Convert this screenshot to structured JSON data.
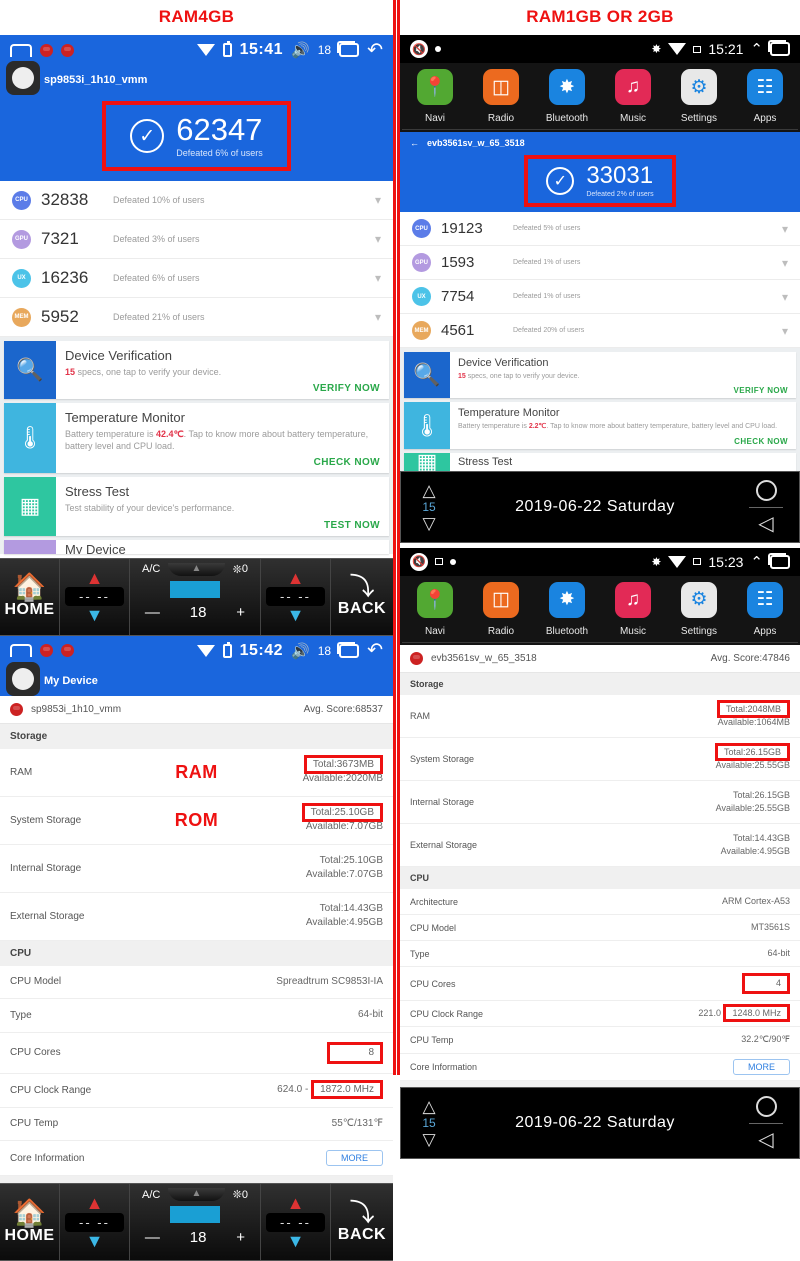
{
  "captions": {
    "left": "RAM4GB",
    "right": "RAM1GB OR 2GB"
  },
  "colors": {
    "accent_red": "#ee1111",
    "android_blue": "#1a66dd",
    "green_action": "#2aa84a",
    "cpu_badge": "#5b7ce8",
    "gpu_badge": "#b39ae0",
    "ux_badge": "#4cc3e8",
    "mem_badge": "#e8a85c"
  },
  "left": {
    "statusbar": {
      "home_icon": "home-outline-icon",
      "bug_icon_1": "bug-icon",
      "bug_icon_2": "bug-icon",
      "wifi_icon": "wifi-icon",
      "battery_icon": "battery-icon",
      "clock": "15:41",
      "volume_icon": "speaker-icon",
      "volume_value": "18",
      "recents_icon": "recents-icon",
      "back_icon": "back-arrow-icon"
    },
    "device_name": "sp9853i_1h10_vmm",
    "score": {
      "check_icon": "check-circle-icon",
      "value": "62347",
      "sub": "Defeated 6% of users",
      "highlighted": true
    },
    "metrics": [
      {
        "badge": "CPU",
        "value": "32838",
        "sub": "Defeated 10% of users",
        "chevron": "chevron-down-icon"
      },
      {
        "badge": "GPU",
        "value": "7321",
        "sub": "Defeated 3% of users",
        "chevron": "chevron-down-icon"
      },
      {
        "badge": "UX",
        "value": "16236",
        "sub": "Defeated 6% of users",
        "chevron": "chevron-down-icon"
      },
      {
        "badge": "MEM",
        "value": "5952",
        "sub": "Defeated 21% of users",
        "chevron": "chevron-down-icon"
      }
    ],
    "cards": [
      {
        "icon": "phone-search-icon",
        "title": "Device Verification",
        "desc_pre": "",
        "desc_em": "15",
        "desc_post": " specs, one tap to verify your device.",
        "action": "VERIFY NOW",
        "color": "#1b66cc"
      },
      {
        "icon": "thermometer-chart-icon",
        "title": "Temperature Monitor",
        "desc_pre": "Battery temperature is ",
        "desc_em": "42.4℃",
        "desc_post": ". Tap to know more about battery temperature, battery level and CPU load.",
        "action": "CHECK NOW",
        "color": "#3fb5df"
      },
      {
        "icon": "cpu-chip-icon",
        "title": "Stress Test",
        "desc_pre": "Test stability of your device's performance.",
        "desc_em": "",
        "desc_post": "",
        "action": "TEST NOW",
        "color": "#2ec6a0"
      }
    ],
    "partial_row": "My Device",
    "hmi": {
      "home_label": "HOME",
      "home_icon": "house-icon",
      "back_label": "BACK",
      "back_icon": "back-arrow-icon",
      "ac_label": "A/C",
      "fan_icon": "fan-icon",
      "fan_value": "0",
      "temp_value": "18",
      "minus": "—",
      "plus": "+",
      "left_temp": "-- --",
      "right_temp": "-- --",
      "up_icon": "chevron-up-icon",
      "down_icon": "chevron-down-icon"
    },
    "detail": {
      "statusbar_clock": "15:42",
      "statusbar_volume": "18",
      "title": "My Device",
      "device_name": "sp9853i_1h10_vmm",
      "avg_score_label": "Avg. Score:68537",
      "storage_head": "Storage",
      "overlay_ram": "RAM",
      "overlay_rom": "ROM",
      "storage_rows": [
        {
          "key": "RAM",
          "total": "Total:3673MB",
          "available": "Available:2020MB",
          "highlight": "total"
        },
        {
          "key": "System Storage",
          "total": "Total:25.10GB",
          "available": "Available:7.07GB",
          "highlight": "total"
        },
        {
          "key": "Internal Storage",
          "total": "Total:25.10GB",
          "available": "Available:7.07GB",
          "highlight": "none"
        },
        {
          "key": "External Storage",
          "total": "Total:14.43GB",
          "available": "Available:4.95GB",
          "highlight": "none"
        }
      ],
      "cpu_head": "CPU",
      "cpu_rows": [
        {
          "key": "CPU Model",
          "value": "Spreadtrum SC9853I-IA",
          "highlight": "none"
        },
        {
          "key": "Type",
          "value": "64-bit",
          "highlight": "none"
        },
        {
          "key": "CPU Cores",
          "value": "8",
          "highlight": "value"
        },
        {
          "key": "CPU Clock Range",
          "value": "624.0 - 1872.0 MHz",
          "value_pre": "624.0 -",
          "value_hl": "1872.0 MHz",
          "highlight": "partial"
        },
        {
          "key": "CPU Temp",
          "value": "55℃/131℉",
          "highlight": "none"
        },
        {
          "key": "Core Information",
          "value": "MORE",
          "highlight": "button"
        }
      ]
    }
  },
  "right": {
    "statusbar": {
      "mute_icon": "mute-speaker-icon",
      "dot_icon": "dot-icon",
      "bluetooth_icon": "bluetooth-icon",
      "wifi_icon": "wifi-icon",
      "sd_icon": "sdcard-off-icon",
      "clock": "15:21",
      "chevron_up_icon": "chevron-up-icon",
      "recents_icon": "recents-icon"
    },
    "apps": [
      {
        "name": "Navi",
        "icon": "location-pin-icon",
        "color": "#52a832"
      },
      {
        "name": "Radio",
        "icon": "radio-icon",
        "color": "#ec6a1f"
      },
      {
        "name": "Bluetooth",
        "icon": "bluetooth-icon",
        "color": "#1a84e0"
      },
      {
        "name": "Music",
        "icon": "music-note-icon",
        "color": "#e22a56"
      },
      {
        "name": "Settings",
        "icon": "gear-icon",
        "color": "#e8e8e8"
      },
      {
        "name": "Apps",
        "icon": "grid-apps-icon",
        "color": "#1a84e0"
      }
    ],
    "back_icon": "back-arrow-icon",
    "device_name": "evb3561sv_w_65_3518",
    "score": {
      "check_icon": "check-circle-icon",
      "value": "33031",
      "sub": "Defeated 2% of users",
      "highlighted": true
    },
    "metrics": [
      {
        "badge": "CPU",
        "value": "19123",
        "sub": "Defeated 5% of users",
        "chevron": "chevron-down-icon"
      },
      {
        "badge": "GPU",
        "value": "1593",
        "sub": "Defeated 1% of users",
        "chevron": "chevron-down-icon"
      },
      {
        "badge": "UX",
        "value": "7754",
        "sub": "Defeated 1% of users",
        "chevron": "chevron-down-icon"
      },
      {
        "badge": "MEM",
        "value": "4561",
        "sub": "Defeated 20% of users",
        "chevron": "chevron-down-icon"
      }
    ],
    "cards": [
      {
        "icon": "phone-search-icon",
        "title": "Device Verification",
        "desc_pre": "",
        "desc_em": "15",
        "desc_post": " specs, one tap to verify your device.",
        "action": "VERIFY NOW",
        "color": "#1b66cc"
      },
      {
        "icon": "thermometer-chart-icon",
        "title": "Temperature Monitor",
        "desc_pre": "Battery temperature is ",
        "desc_em": "2.2℃",
        "desc_post": ". Tap to know more about battery temperature, battery level and CPU load.",
        "action": "CHECK NOW",
        "color": "#3fb5df"
      },
      {
        "icon": "cpu-chip-icon",
        "title": "Stress Test",
        "desc_pre": "",
        "desc_em": "",
        "desc_post": "",
        "action": "",
        "color": "#2ec6a0"
      }
    ],
    "datebar": {
      "up_icon": "triangle-up-icon",
      "down_icon": "triangle-down-icon",
      "number": "15",
      "date": "2019-06-22  Saturday",
      "circle_icon": "circle-icon",
      "back_icon": "triangle-left-icon"
    },
    "detail": {
      "statusbar_clock": "15:23",
      "device_name": "evb3561sv_w_65_3518",
      "avg_score_label": "Avg. Score:47846",
      "storage_head": "Storage",
      "storage_rows": [
        {
          "key": "RAM",
          "total": "Total:2048MB",
          "available": "Available:1064MB",
          "highlight": "total"
        },
        {
          "key": "System Storage",
          "total": "Total:26.15GB",
          "available": "Available:25.55GB",
          "highlight": "total"
        },
        {
          "key": "Internal Storage",
          "total": "Total:26.15GB",
          "available": "Available:25.55GB",
          "highlight": "none"
        },
        {
          "key": "External Storage",
          "total": "Total:14.43GB",
          "available": "Available:4.95GB",
          "highlight": "none"
        }
      ],
      "cpu_head": "CPU",
      "cpu_rows": [
        {
          "key": "Architecture",
          "value": "ARM Cortex-A53",
          "highlight": "none"
        },
        {
          "key": "CPU Model",
          "value": "MT3561S",
          "highlight": "none"
        },
        {
          "key": "Type",
          "value": "64-bit",
          "highlight": "none"
        },
        {
          "key": "CPU Cores",
          "value": "4",
          "highlight": "value"
        },
        {
          "key": "CPU Clock Range",
          "value": "221.0 - 1248.0 MHz",
          "value_pre": "221.0",
          "value_hl": "1248.0 MHz",
          "highlight": "partial"
        },
        {
          "key": "CPU Temp",
          "value": "32.2℃/90℉",
          "highlight": "none"
        },
        {
          "key": "Core Information",
          "value": "MORE",
          "highlight": "button"
        }
      ]
    }
  }
}
